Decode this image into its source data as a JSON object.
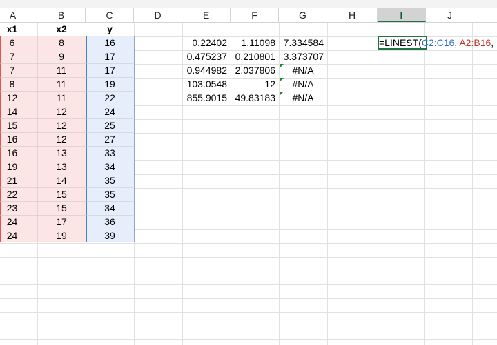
{
  "columns": [
    "A",
    "B",
    "C",
    "D",
    "E",
    "F",
    "G",
    "H",
    "I",
    "J"
  ],
  "headers": {
    "a": "x1",
    "b": "x2",
    "c": "y"
  },
  "data_rows": [
    {
      "x1": "6",
      "x2": "8",
      "y": "16"
    },
    {
      "x1": "7",
      "x2": "9",
      "y": "17"
    },
    {
      "x1": "7",
      "x2": "11",
      "y": "17"
    },
    {
      "x1": "8",
      "x2": "11",
      "y": "19"
    },
    {
      "x1": "12",
      "x2": "11",
      "y": "22"
    },
    {
      "x1": "14",
      "x2": "12",
      "y": "24"
    },
    {
      "x1": "15",
      "x2": "12",
      "y": "25"
    },
    {
      "x1": "16",
      "x2": "12",
      "y": "27"
    },
    {
      "x1": "16",
      "x2": "13",
      "y": "33"
    },
    {
      "x1": "19",
      "x2": "13",
      "y": "34"
    },
    {
      "x1": "21",
      "x2": "14",
      "y": "35"
    },
    {
      "x1": "22",
      "x2": "15",
      "y": "35"
    },
    {
      "x1": "23",
      "x2": "15",
      "y": "34"
    },
    {
      "x1": "24",
      "x2": "17",
      "y": "36"
    },
    {
      "x1": "24",
      "x2": "19",
      "y": "39"
    }
  ],
  "output_rows": [
    {
      "e": "0.22402",
      "f": "1.11098",
      "g": "7.334584"
    },
    {
      "e": "0.475237",
      "f": "0.210801",
      "g": "3.373707"
    },
    {
      "e": "0.944982",
      "f": "2.037806",
      "g": "#N/A"
    },
    {
      "e": "103.0548",
      "f": "12",
      "g": "#N/A"
    },
    {
      "e": "855.9015",
      "f": "49.83183",
      "g": "#N/A"
    }
  ],
  "formula": {
    "prefix": "=LINEST(",
    "ref1": "C2:C16",
    "sep": ", ",
    "ref2": "A2:B16",
    "suffix": ", , T"
  },
  "colors": {
    "red_range_fill": "#fbe5e5",
    "red_range_border": "#e05454",
    "blue_range_fill": "#e7eefb",
    "blue_range_border": "#4b7fd1",
    "active_cell_border": "#217346",
    "error_indicator": "#1e8a3a"
  },
  "selected_column": "I"
}
